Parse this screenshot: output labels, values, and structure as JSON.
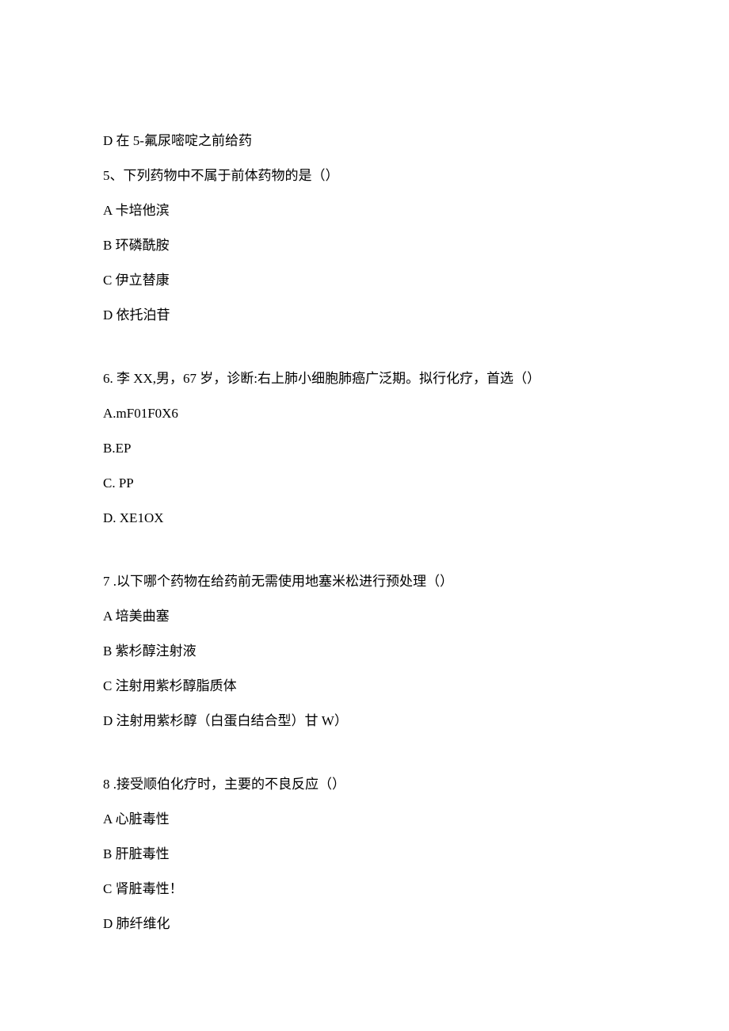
{
  "lines": {
    "q4_d": "D 在 5-氟尿嘧啶之前给药",
    "q5_stem": "5、下列药物中不属于前体药物的是（）",
    "q5_a": "A 卡培他滨",
    "q5_b": "B 环磷酰胺",
    "q5_c": "C 伊立替康",
    "q5_d": "D 依托泊苷",
    "q6_stem": "6. 李 XX,男，67 岁，诊断:右上肺小细胞肺癌广泛期。拟行化疗，首选（）",
    "q6_a": "A.mF01F0X6",
    "q6_b": "B.EP",
    "q6_c": "C.    PP",
    "q6_d": "D.    XE1OX",
    "q7_stem": "7  .以下哪个药物在给药前无需使用地塞米松进行预处理（）",
    "q7_a": "A 培美曲塞",
    "q7_b": "B 紫杉醇注射液",
    "q7_c": "C 注射用紫杉醇脂质体",
    "q7_d": "D 注射用紫杉醇（白蛋白结合型）甘 W）",
    "q8_stem": "8  .接受顺伯化疗时，主要的不良反应（）",
    "q8_a": "A 心脏毒性",
    "q8_b": "B 肝脏毒性",
    "q8_c": "C 肾脏毒性！",
    "q8_d": "D 肺纤维化"
  }
}
